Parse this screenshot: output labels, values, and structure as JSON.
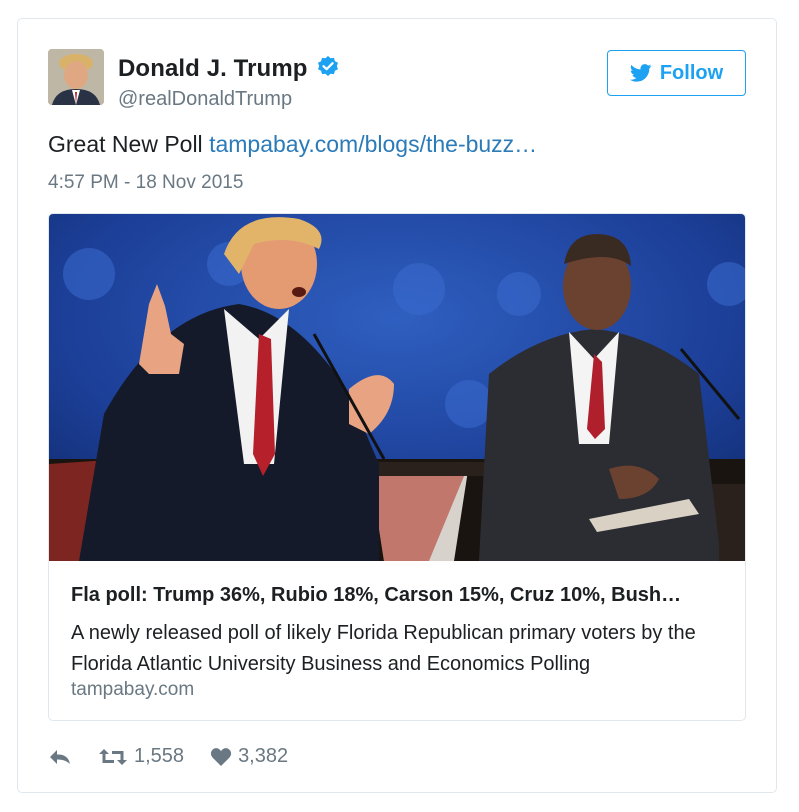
{
  "author": {
    "display_name": "Donald J. Trump",
    "handle": "@realDonaldTrump",
    "verified": true,
    "avatar_icon": "profile-photo"
  },
  "follow_button": {
    "label": "Follow",
    "icon": "twitter-bird-icon"
  },
  "tweet": {
    "text": "Great New Poll ",
    "link_text": "tampabay.com/blogs/the-buzz…",
    "timestamp": "4:57 PM - 18 Nov 2015"
  },
  "card": {
    "image_description_icon": "debate-photo",
    "title": "Fla poll: Trump 36%, Rubio 18%, Carson 15%, Cruz 10%, Bush…",
    "description": "A newly released poll of likely Florida Republican primary voters by the Florida Atlantic University Business and Economics Polling",
    "domain": "tampabay.com"
  },
  "actions": {
    "reply_icon": "reply-icon",
    "retweet_icon": "retweet-icon",
    "retweet_count": "1,558",
    "like_icon": "heart-icon",
    "like_count": "3,382"
  },
  "colors": {
    "twitter_blue": "#1da1f2",
    "link": "#2b7bb9",
    "muted": "#697882",
    "border": "#e1e8ed"
  }
}
